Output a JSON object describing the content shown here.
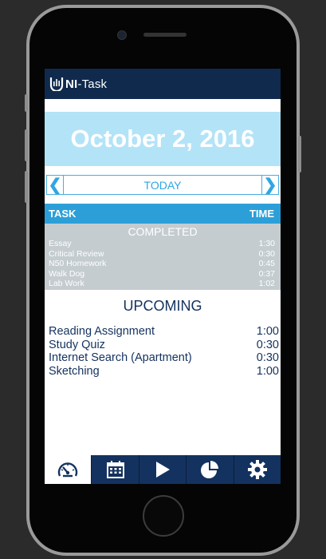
{
  "app": {
    "name_prefix": "NI",
    "name_suffix": "-Task",
    "logo_icon": "u-bar-chart-icon"
  },
  "date_banner": {
    "text": "October 2, 2016"
  },
  "date_nav": {
    "prev": "❮",
    "label": "TODAY",
    "next": "❯"
  },
  "task_table": {
    "task_header": "TASK",
    "time_header": "TIME"
  },
  "completed": {
    "title": "COMPLETED",
    "items": [
      {
        "task": "Essay",
        "time": "1:30"
      },
      {
        "task": "Critical Review",
        "time": "0:30"
      },
      {
        "task": "N50 Homework",
        "time": "0:45"
      },
      {
        "task": "Walk Dog",
        "time": "0:37"
      },
      {
        "task": "Lab Work",
        "time": "1:02"
      }
    ]
  },
  "upcoming": {
    "title": "UPCOMING",
    "items": [
      {
        "task": "Reading Assignment",
        "time": "1:00"
      },
      {
        "task": "Study Quiz",
        "time": "0:30"
      },
      {
        "task": "Internet Search (Apartment)",
        "time": "0:30"
      },
      {
        "task": "Sketching",
        "time": "1:00"
      }
    ]
  },
  "tab_bar": {
    "tabs": [
      {
        "icon": "speedometer-icon",
        "active": true
      },
      {
        "icon": "calendar-icon",
        "active": false
      },
      {
        "icon": "play-icon",
        "active": false
      },
      {
        "icon": "pie-chart-icon",
        "active": false
      },
      {
        "icon": "gear-icon",
        "active": false
      }
    ]
  },
  "colors": {
    "header_navy": "#0f2a4d",
    "accent_blue": "#2d9fd8",
    "banner_light_blue": "#b3e3f7",
    "completed_gray": "#c4ccd0",
    "text_navy": "#14325f"
  }
}
